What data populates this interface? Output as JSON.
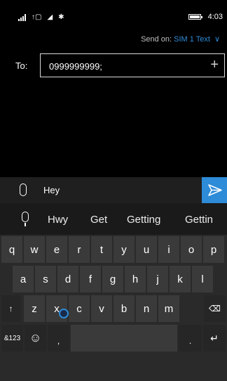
{
  "status": {
    "time": "4:03",
    "battery_level": 0.85
  },
  "header": {
    "send_on_label": "Send on:",
    "sim_label": "SIM 1 Text",
    "chevron": "∨"
  },
  "recipient": {
    "label": "To:",
    "value": "0999999999;",
    "add_glyph": "+"
  },
  "compose": {
    "message": "Hey"
  },
  "suggestions": [
    "Hwy",
    "Get",
    "Getting",
    "Gettin"
  ],
  "keyboard": {
    "row1": [
      "q",
      "w",
      "e",
      "r",
      "t",
      "y",
      "u",
      "i",
      "o",
      "p"
    ],
    "row2": [
      "a",
      "s",
      "d",
      "f",
      "g",
      "h",
      "j",
      "k",
      "l"
    ],
    "row3": [
      "z",
      "x",
      "c",
      "v",
      "b",
      "n",
      "m"
    ],
    "shift": "↑",
    "backspace": "⌫",
    "num_key": "&123",
    "emoji": "☺",
    "comma": ",",
    "period": ".",
    "enter": "↵"
  },
  "colors": {
    "accent": "#2d8bd8",
    "background": "#000000",
    "key": "#3a3a3a",
    "key_dark": "#262626"
  }
}
